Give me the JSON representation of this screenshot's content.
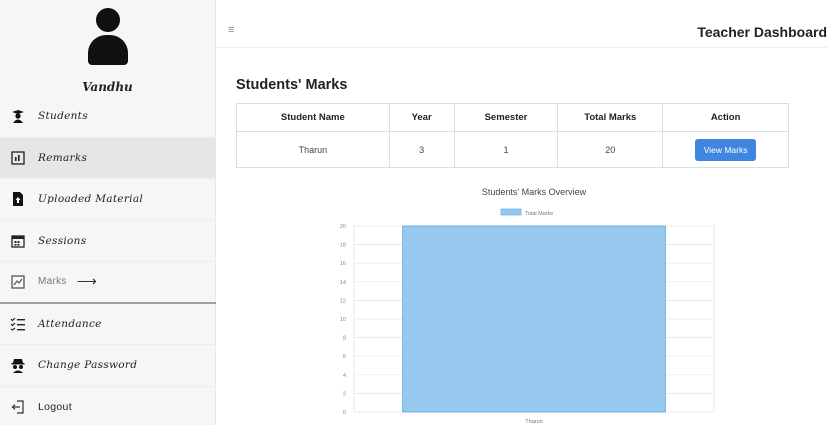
{
  "sidebar": {
    "user_name": "Vandhu",
    "items": [
      {
        "label": "Students",
        "icon": "student-icon"
      },
      {
        "label": "Remarks",
        "icon": "remarks-icon"
      },
      {
        "label": "Uploaded Material",
        "icon": "upload-file-icon"
      },
      {
        "label": "Sessions",
        "icon": "calendar-icon"
      },
      {
        "label": "Marks",
        "icon": "marks-icon",
        "arrow": "⟶"
      },
      {
        "label": "Attendance",
        "icon": "checklist-icon"
      },
      {
        "label": "Change Password",
        "icon": "incognito-icon"
      },
      {
        "label": "Logout",
        "icon": "logout-icon"
      }
    ]
  },
  "header": {
    "menu_icon": "≡",
    "title": "Teacher Dashboard"
  },
  "main": {
    "title": "Students' Marks",
    "table": {
      "columns": [
        "Student Name",
        "Year",
        "Semester",
        "Total Marks",
        "Action"
      ],
      "rows": [
        {
          "name": "Tharun",
          "year": "3",
          "semester": "1",
          "total": "20",
          "action": "View Marks"
        }
      ]
    }
  },
  "chart_data": {
    "type": "bar",
    "title": "Students' Marks Overview",
    "categories": [
      "Tharun"
    ],
    "series": [
      {
        "name": "Total Marks",
        "values": [
          20
        ]
      }
    ],
    "ylim": [
      0,
      20
    ],
    "yticks": [
      0,
      2,
      4,
      6,
      8,
      10,
      12,
      14,
      16,
      18,
      20
    ],
    "grid": true,
    "legend": "top",
    "colors": {
      "bar_fill": "#97c9ef",
      "bar_stroke": "#5aa7e0"
    }
  }
}
